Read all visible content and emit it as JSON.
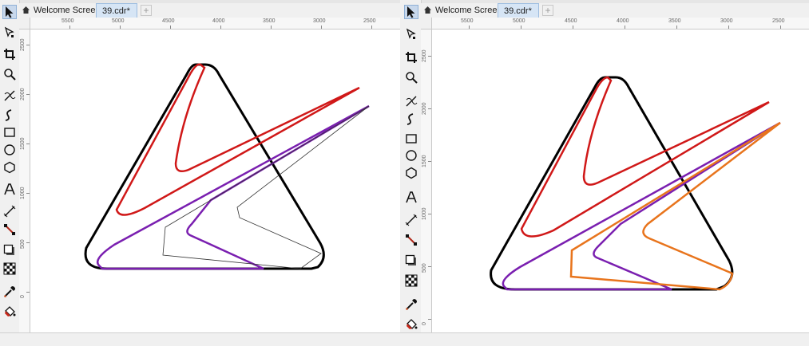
{
  "tabs": {
    "welcome_label": "Welcome Screen",
    "file_label": "39.cdr*",
    "new_tab_label": "+"
  },
  "ruler": {
    "h_labels_left": [
      "5500",
      "5000",
      "4500",
      "4000",
      "3500",
      "3000",
      "2500"
    ],
    "h_labels_right": [
      "5500",
      "5000",
      "4500",
      "4000",
      "3500",
      "3000",
      "2500"
    ],
    "v_labels": [
      "2500",
      "2000",
      "1500",
      "1000",
      "500",
      "0"
    ]
  },
  "tools": [
    "pick-tool-icon",
    "shape-tool-icon",
    "crop-tool-icon",
    "zoom-tool-icon",
    "freehand-tool-icon",
    "artistic-media-tool-icon",
    "rectangle-tool-icon",
    "ellipse-tool-icon",
    "polygon-tool-icon",
    "text-tool-icon",
    "parallel-dimension-tool-icon",
    "connector-tool-icon",
    "drop-shadow-tool-icon",
    "transparency-tool-icon",
    "color-eyedropper-tool-icon",
    "interactive-fill-tool-icon"
  ],
  "colors": {
    "triangle": "#000000",
    "red_curve": "#d01818",
    "purple_curve": "#7a1fb0",
    "hairline": "#333333",
    "orange_curve": "#e8741c"
  }
}
